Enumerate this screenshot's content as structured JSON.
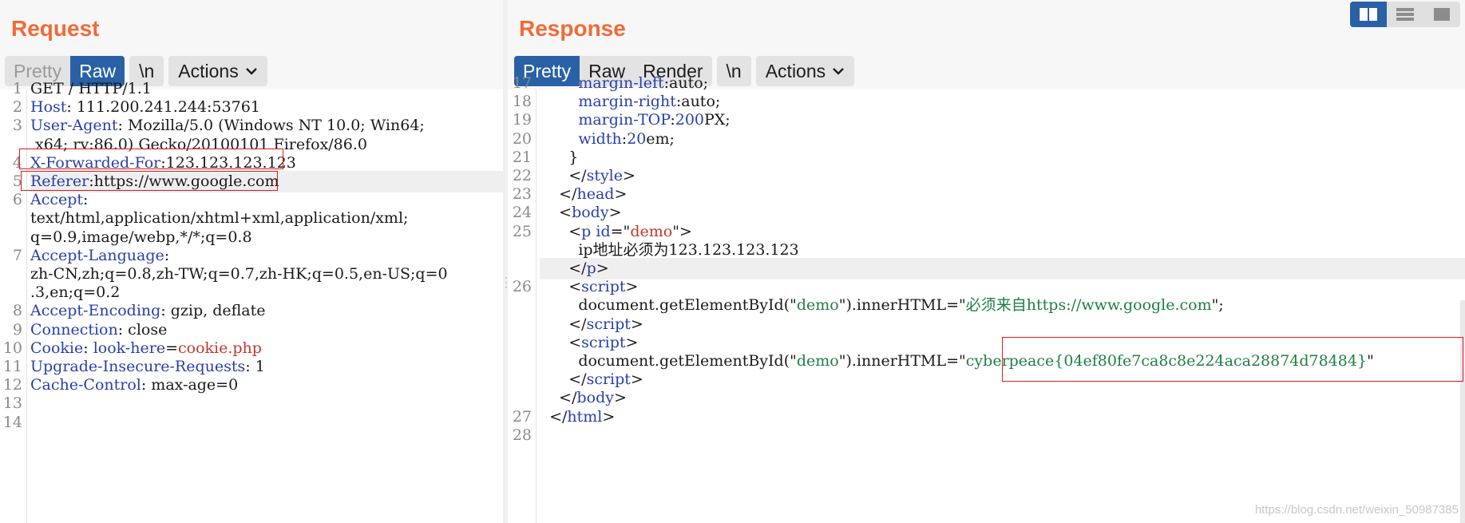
{
  "request": {
    "title": "Request",
    "tabs": [
      "Pretty",
      "Raw"
    ],
    "newline_toggle": "\\n",
    "actions_label": "Actions",
    "lines": [
      {
        "n": "1",
        "parts": [
          [
            "GET / HTTP/1.1",
            "p"
          ]
        ]
      },
      {
        "n": "2",
        "parts": [
          [
            "Host",
            "k"
          ],
          [
            ": 111.200.241.244:53761",
            "p"
          ]
        ]
      },
      {
        "n": "3",
        "parts": [
          [
            "User-Agent",
            "k"
          ],
          [
            ": Mozilla/5.0 (Windows NT 10.0; Win64;",
            "p"
          ]
        ]
      },
      {
        "n": "",
        "parts": [
          [
            " x64; rv:86.0) Gecko/20100101 Firefox/86.0",
            "p"
          ]
        ]
      },
      {
        "n": "4",
        "parts": [
          [
            "X-Forwarded-For",
            "k"
          ],
          [
            ":123.123.123.123",
            "p"
          ]
        ]
      },
      {
        "n": "5",
        "parts": [
          [
            "Referer",
            "k"
          ],
          [
            ":https://www.google.com",
            "p"
          ]
        ],
        "hl": true
      },
      {
        "n": "6",
        "parts": [
          [
            "Accept",
            "k"
          ],
          [
            ":",
            "p"
          ]
        ]
      },
      {
        "n": "",
        "parts": [
          [
            "text/html,application/xhtml+xml,application/xml;",
            "p"
          ]
        ]
      },
      {
        "n": "",
        "parts": [
          [
            "q=0.9,image/webp,*/*;q=0.8",
            "p"
          ]
        ]
      },
      {
        "n": "7",
        "parts": [
          [
            "Accept-Language",
            "k"
          ],
          [
            ":",
            "p"
          ]
        ]
      },
      {
        "n": "",
        "parts": [
          [
            "zh-CN,zh;q=0.8,zh-TW;q=0.7,zh-HK;q=0.5,en-US;q=0",
            "p"
          ]
        ]
      },
      {
        "n": "",
        "parts": [
          [
            ".3,en;q=0.2",
            "p"
          ]
        ]
      },
      {
        "n": "8",
        "parts": [
          [
            "Accept-Encoding",
            "k"
          ],
          [
            ": gzip, deflate",
            "p"
          ]
        ]
      },
      {
        "n": "9",
        "parts": [
          [
            "Connection",
            "k"
          ],
          [
            ": close",
            "p"
          ]
        ]
      },
      {
        "n": "10",
        "parts": [
          [
            "Cookie",
            "k"
          ],
          [
            ": ",
            "p"
          ],
          [
            "look-here",
            "k"
          ],
          [
            "=",
            "p"
          ],
          [
            "cookie.php",
            "r"
          ]
        ]
      },
      {
        "n": "11",
        "parts": [
          [
            "Upgrade-Insecure-Requests",
            "k"
          ],
          [
            ": 1",
            "p"
          ]
        ]
      },
      {
        "n": "12",
        "parts": [
          [
            "Cache-Control",
            "k"
          ],
          [
            ": max-age=0",
            "p"
          ]
        ]
      },
      {
        "n": "13",
        "parts": []
      },
      {
        "n": "14",
        "parts": []
      }
    ]
  },
  "response": {
    "title": "Response",
    "tabs": [
      "Pretty",
      "Raw",
      "Render"
    ],
    "newline_toggle": "\\n",
    "actions_label": "Actions",
    "lines": [
      {
        "n": "17",
        "parts": [
          [
            "        margin-left",
            "k"
          ],
          [
            ":auto;",
            "p"
          ]
        ]
      },
      {
        "n": "18",
        "parts": [
          [
            "        margin-right",
            "k"
          ],
          [
            ":auto;",
            "p"
          ]
        ]
      },
      {
        "n": "19",
        "parts": [
          [
            "        margin-TOP",
            "k"
          ],
          [
            ":",
            "p"
          ],
          [
            "200",
            "n"
          ],
          [
            "PX;",
            "p"
          ]
        ]
      },
      {
        "n": "20",
        "parts": [
          [
            "        width",
            "k"
          ],
          [
            ":",
            "p"
          ],
          [
            "20",
            "n"
          ],
          [
            "em;",
            "p"
          ]
        ]
      },
      {
        "n": "21",
        "parts": [
          [
            "      }",
            "p"
          ]
        ]
      },
      {
        "n": "22",
        "parts": [
          [
            "      </",
            "p"
          ],
          [
            "style",
            "t"
          ],
          [
            ">",
            "p"
          ]
        ]
      },
      {
        "n": "23",
        "parts": [
          [
            "    </",
            "p"
          ],
          [
            "head",
            "t"
          ],
          [
            ">",
            "p"
          ]
        ]
      },
      {
        "n": "24",
        "parts": [
          [
            "    <",
            "p"
          ],
          [
            "body",
            "t"
          ],
          [
            ">",
            "p"
          ]
        ]
      },
      {
        "n": "25",
        "parts": [
          [
            "      <",
            "p"
          ],
          [
            "p",
            "t"
          ],
          [
            " ",
            "p"
          ],
          [
            "id",
            "t"
          ],
          [
            "=\"",
            "p"
          ],
          [
            "demo",
            "r"
          ],
          [
            "\">",
            "p"
          ]
        ]
      },
      {
        "n": "",
        "parts": [
          [
            "        ip地址必须为123.123.123.123",
            "p"
          ]
        ]
      },
      {
        "n": "",
        "parts": [
          [
            "      </",
            "p"
          ],
          [
            "p",
            "t"
          ],
          [
            ">",
            "p"
          ]
        ],
        "hl": true
      },
      {
        "n": "26",
        "parts": [
          [
            "      <",
            "p"
          ],
          [
            "script",
            "t"
          ],
          [
            ">",
            "p"
          ]
        ]
      },
      {
        "n": "",
        "parts": [
          [
            "        document.getElementById(\"",
            "p"
          ],
          [
            "demo",
            "g"
          ],
          [
            "\").innerHTML=\"",
            "p"
          ],
          [
            "必须来自https://www.google.com",
            "g"
          ],
          [
            "\";",
            "p"
          ]
        ]
      },
      {
        "n": "",
        "parts": [
          [
            "      </",
            "p"
          ],
          [
            "script",
            "t"
          ],
          [
            ">",
            "p"
          ]
        ]
      },
      {
        "n": "",
        "parts": [
          [
            "      <",
            "p"
          ],
          [
            "script",
            "t"
          ],
          [
            ">",
            "p"
          ]
        ]
      },
      {
        "n": "",
        "parts": [
          [
            "        document.getElementById(\"",
            "p"
          ],
          [
            "demo",
            "g"
          ],
          [
            "\").innerHTML=\"",
            "p"
          ],
          [
            "cyberpeace{04ef80fe7ca8c8e224aca28874d78484}",
            "g"
          ],
          [
            "\"",
            "p"
          ]
        ]
      },
      {
        "n": "",
        "parts": [
          [
            "      </",
            "p"
          ],
          [
            "script",
            "t"
          ],
          [
            ">",
            "p"
          ]
        ]
      },
      {
        "n": "",
        "parts": [
          [
            "    </",
            "p"
          ],
          [
            "body",
            "t"
          ],
          [
            ">",
            "p"
          ]
        ]
      },
      {
        "n": "27",
        "parts": [
          [
            "  </",
            "p"
          ],
          [
            "html",
            "t"
          ],
          [
            ">",
            "p"
          ]
        ]
      },
      {
        "n": "28",
        "parts": []
      }
    ]
  },
  "layout_switch": [
    "split-horizontal-icon",
    "split-vertical-icon",
    "single-pane-icon"
  ],
  "watermark": "https://blog.csdn.net/weixin_50987385",
  "colors": {
    "accent": "#f26a36",
    "active_tab": "#2a61a6",
    "highlight_box": "#e0191e",
    "header_key": "#283fa8",
    "string_green": "#1f7f44",
    "value_red": "#c0392b"
  }
}
